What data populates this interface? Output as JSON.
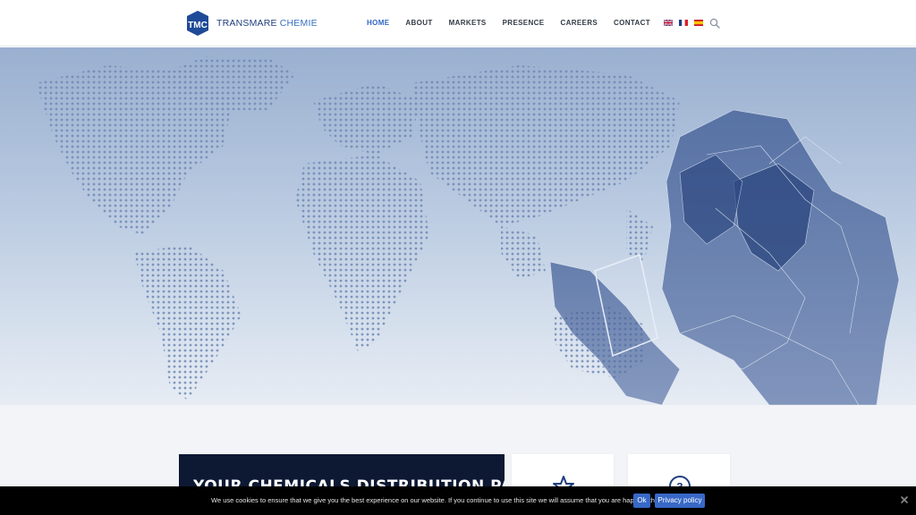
{
  "brand": {
    "logo_mark": "TMC",
    "name_part1": "TRANSMARE",
    "name_part2": "CHEMIE",
    "colors": {
      "primary": "#1f3f7f",
      "accent": "#3670c4"
    }
  },
  "nav": {
    "items": [
      {
        "label": "HOME",
        "active": true
      },
      {
        "label": "ABOUT"
      },
      {
        "label": "MARKETS"
      },
      {
        "label": "PRESENCE"
      },
      {
        "label": "CAREERS"
      },
      {
        "label": "CONTACT"
      }
    ],
    "flags": [
      "english-flag-icon",
      "french-flag-icon",
      "spanish-flag-icon"
    ],
    "search_icon": "search-icon"
  },
  "hero": {
    "image": "world-map-with-polygonal-human-figures"
  },
  "cards": {
    "headline": "YOUR CHEMICALS DISTRIBUTION PARTNER",
    "icons": [
      "star-icon",
      "three-circle-icon"
    ]
  },
  "cookie": {
    "text": "We use cookies to ensure that we give you the best experience on our website. If you continue to use this site we will assume that you are happy with it.",
    "ok_label": "Ok",
    "privacy_label": "Privacy policy",
    "close_icon": "close-icon"
  }
}
